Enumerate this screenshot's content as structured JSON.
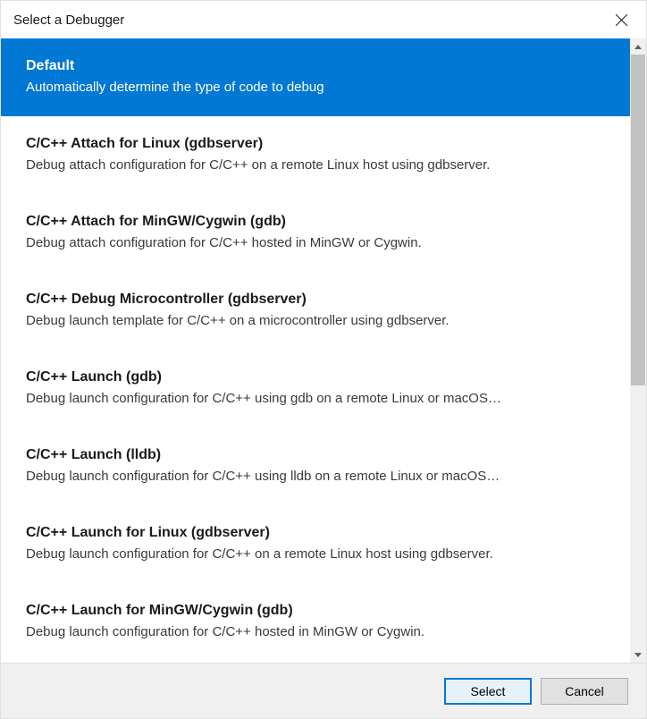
{
  "window": {
    "title": "Select a Debugger"
  },
  "debuggers": [
    {
      "title": "Default",
      "desc": "Automatically determine the type of code to debug",
      "selected": true
    },
    {
      "title": "C/C++ Attach for Linux (gdbserver)",
      "desc": "Debug attach configuration for C/C++ on a remote Linux host using gdbserver."
    },
    {
      "title": "C/C++ Attach for MinGW/Cygwin (gdb)",
      "desc": "Debug attach configuration for C/C++ hosted in MinGW or Cygwin."
    },
    {
      "title": "C/C++ Debug Microcontroller (gdbserver)",
      "desc": "Debug launch template for C/C++ on a microcontroller using gdbserver."
    },
    {
      "title": "C/C++ Launch (gdb)",
      "desc": "Debug launch configuration for C/C++ using gdb on a remote Linux or macOS…"
    },
    {
      "title": "C/C++ Launch (lldb)",
      "desc": "Debug launch configuration for C/C++ using lldb on a remote Linux or macOS…"
    },
    {
      "title": "C/C++ Launch for Linux (gdbserver)",
      "desc": "Debug launch configuration for C/C++ on a remote Linux host using gdbserver."
    },
    {
      "title": "C/C++ Launch for MinGW/Cygwin (gdb)",
      "desc": "Debug launch configuration for C/C++ hosted in MinGW or Cygwin."
    }
  ],
  "footer": {
    "select_label": "Select",
    "cancel_label": "Cancel"
  }
}
